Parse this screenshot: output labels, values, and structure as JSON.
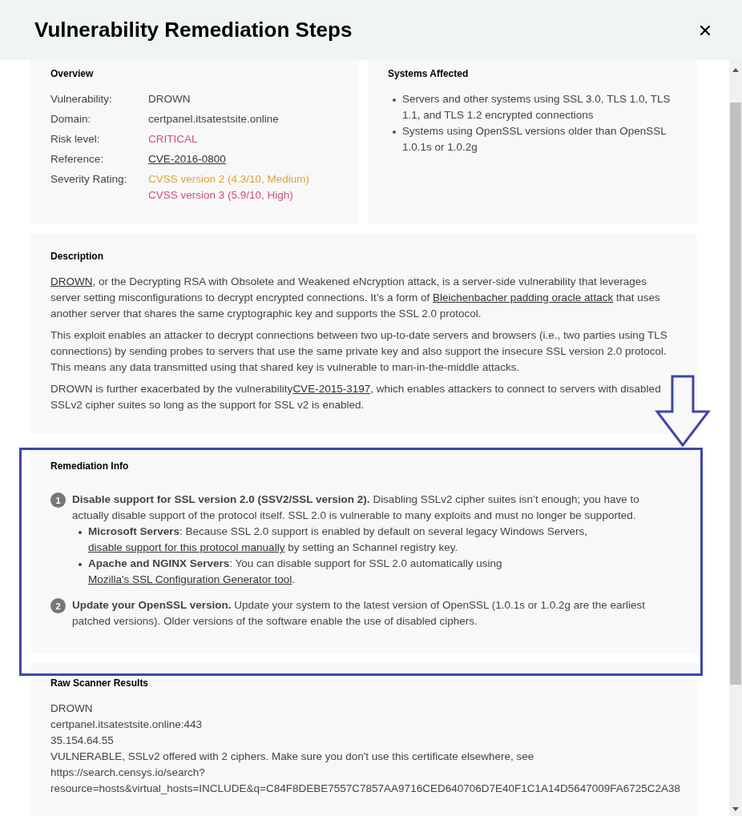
{
  "dialog": {
    "title": "Vulnerability Remediation Steps"
  },
  "overview": {
    "heading": "Overview",
    "rows": [
      {
        "label": "Vulnerability:",
        "values": [
          {
            "text": "DROWN",
            "kind": "plain"
          }
        ]
      },
      {
        "label": "Domain:",
        "values": [
          {
            "text": "certpanel.itsatestsite.online",
            "kind": "plain"
          }
        ]
      },
      {
        "label": "Risk level:",
        "values": [
          {
            "text": "CRITICAL",
            "kind": "danger"
          }
        ]
      },
      {
        "label": "Reference:",
        "values": [
          {
            "text": "CVE-2016-0800",
            "kind": "link"
          }
        ]
      },
      {
        "label": "Severity Rating:",
        "values": [
          {
            "text": "CVSS version 2 (4.3/10, Medium)",
            "kind": "warning"
          },
          {
            "text": "CVSS version 3 (5.9/10, High)",
            "kind": "danger"
          }
        ]
      }
    ]
  },
  "systems_affected": {
    "heading": "Systems Affected",
    "items": [
      "Servers and other systems using SSL 3.0, TLS 1.0, TLS 1.1, and TLS 1.2 encrypted connections",
      "Systems using OpenSSL versions older than OpenSSL 1.0.1s or 1.0.2g"
    ]
  },
  "description": {
    "heading": "Description",
    "paragraphs": [
      [
        {
          "link": "DROWN"
        },
        {
          "text": ", or the Decrypting RSA with Obsolete and Weakened eNcryption attack, is a server-side vulnerability that leverages server setting misconfigurations to decrypt encrypted connections. It’s a form of "
        },
        {
          "link": "Bleichenbacher padding oracle attack"
        },
        {
          "text": " that uses another server that shares the same cryptographic key and supports the SSL 2.0 protocol."
        }
      ],
      [
        {
          "text": "This exploit enables an attacker to decrypt connections between two up-to-date servers and browsers (i.e., two parties using TLS connections) by sending probes to servers that use the same private key and also support the insecure SSL version 2.0 protocol. This means any data transmitted using that shared key is vulnerable to man-in-the-middle attacks."
        }
      ],
      [
        {
          "text": "DROWN is further exacerbated by the vulnerability"
        },
        {
          "link": "CVE-2015-3197"
        },
        {
          "text": ", which enables attackers to connect to servers with disabled SSLv2 cipher suites so long as the support for SSL v2 is enabled."
        }
      ]
    ]
  },
  "remediation": {
    "heading": "Remediation Info",
    "steps": [
      {
        "number": "1",
        "segments": [
          {
            "text": "**Disable support for SSL version 2.0 (SSV2/SSL version 2).** Disabling SSLv2 cipher suites isn’t enough; you have to actually disable support of the protocol itself. SSL 2.0 is vulnerable to many exploits and must no longer be supported."
          }
        ],
        "bullets": [
          [
            {
              "text": "**Microsoft Servers**: Because SSL 2.0 support is enabled by default on several legacy Windows Servers, "
            },
            {
              "link": "disable support for this protocol manually"
            },
            {
              "text": " by setting an Schannel registry key."
            }
          ],
          [
            {
              "text": "**Apache and NGINX Servers**: You can disable support for SSL 2.0 automatically using "
            },
            {
              "link": "Mozilla's SSL Configuration Generator tool"
            },
            {
              "text": "."
            }
          ]
        ]
      },
      {
        "number": "2",
        "segments": [
          {
            "text": "**Update your OpenSSL version.** Update your system to the latest version of OpenSSL (1.0.1s or 1.0.2g are the earliest patched versions). Older versions of the software enable the use of disabled ciphers."
          }
        ]
      }
    ]
  },
  "raw_scanner_results": {
    "heading": "Raw Scanner Results",
    "lines": [
      "DROWN",
      "certpanel.itsatestsite.online:443",
      "35.154.64.55",
      "VULNERABLE, SSLv2 offered with 2 ciphers. Make sure you don't use this certificate elsewhere, see",
      "https://search.censys.io/search?",
      "resource=hosts&virtual_hosts=INCLUDE&q=C84F8DEBE7557C7857AA9716CED640706D7E40F1C1A14D5647009FA6725C2A38"
    ]
  }
}
